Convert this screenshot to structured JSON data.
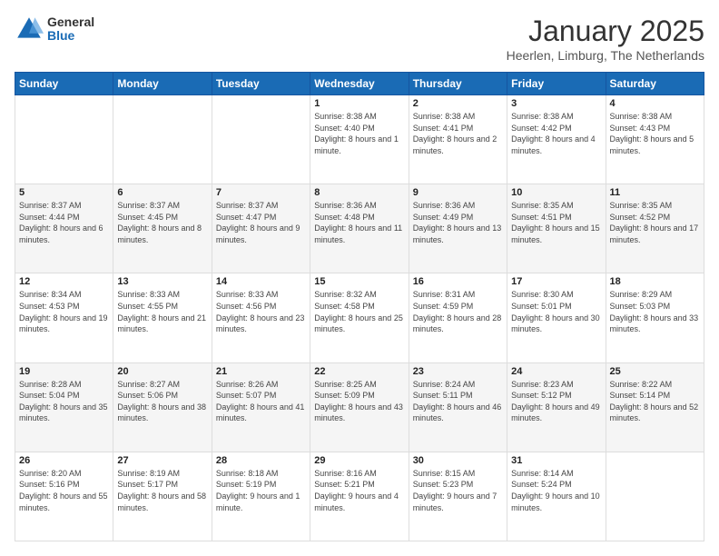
{
  "logo": {
    "general": "General",
    "blue": "Blue"
  },
  "header": {
    "month": "January 2025",
    "location": "Heerlen, Limburg, The Netherlands"
  },
  "weekdays": [
    "Sunday",
    "Monday",
    "Tuesday",
    "Wednesday",
    "Thursday",
    "Friday",
    "Saturday"
  ],
  "weeks": [
    [
      {
        "day": "",
        "sunrise": "",
        "sunset": "",
        "daylight": ""
      },
      {
        "day": "",
        "sunrise": "",
        "sunset": "",
        "daylight": ""
      },
      {
        "day": "",
        "sunrise": "",
        "sunset": "",
        "daylight": ""
      },
      {
        "day": "1",
        "sunrise": "Sunrise: 8:38 AM",
        "sunset": "Sunset: 4:40 PM",
        "daylight": "Daylight: 8 hours and 1 minute."
      },
      {
        "day": "2",
        "sunrise": "Sunrise: 8:38 AM",
        "sunset": "Sunset: 4:41 PM",
        "daylight": "Daylight: 8 hours and 2 minutes."
      },
      {
        "day": "3",
        "sunrise": "Sunrise: 8:38 AM",
        "sunset": "Sunset: 4:42 PM",
        "daylight": "Daylight: 8 hours and 4 minutes."
      },
      {
        "day": "4",
        "sunrise": "Sunrise: 8:38 AM",
        "sunset": "Sunset: 4:43 PM",
        "daylight": "Daylight: 8 hours and 5 minutes."
      }
    ],
    [
      {
        "day": "5",
        "sunrise": "Sunrise: 8:37 AM",
        "sunset": "Sunset: 4:44 PM",
        "daylight": "Daylight: 8 hours and 6 minutes."
      },
      {
        "day": "6",
        "sunrise": "Sunrise: 8:37 AM",
        "sunset": "Sunset: 4:45 PM",
        "daylight": "Daylight: 8 hours and 8 minutes."
      },
      {
        "day": "7",
        "sunrise": "Sunrise: 8:37 AM",
        "sunset": "Sunset: 4:47 PM",
        "daylight": "Daylight: 8 hours and 9 minutes."
      },
      {
        "day": "8",
        "sunrise": "Sunrise: 8:36 AM",
        "sunset": "Sunset: 4:48 PM",
        "daylight": "Daylight: 8 hours and 11 minutes."
      },
      {
        "day": "9",
        "sunrise": "Sunrise: 8:36 AM",
        "sunset": "Sunset: 4:49 PM",
        "daylight": "Daylight: 8 hours and 13 minutes."
      },
      {
        "day": "10",
        "sunrise": "Sunrise: 8:35 AM",
        "sunset": "Sunset: 4:51 PM",
        "daylight": "Daylight: 8 hours and 15 minutes."
      },
      {
        "day": "11",
        "sunrise": "Sunrise: 8:35 AM",
        "sunset": "Sunset: 4:52 PM",
        "daylight": "Daylight: 8 hours and 17 minutes."
      }
    ],
    [
      {
        "day": "12",
        "sunrise": "Sunrise: 8:34 AM",
        "sunset": "Sunset: 4:53 PM",
        "daylight": "Daylight: 8 hours and 19 minutes."
      },
      {
        "day": "13",
        "sunrise": "Sunrise: 8:33 AM",
        "sunset": "Sunset: 4:55 PM",
        "daylight": "Daylight: 8 hours and 21 minutes."
      },
      {
        "day": "14",
        "sunrise": "Sunrise: 8:33 AM",
        "sunset": "Sunset: 4:56 PM",
        "daylight": "Daylight: 8 hours and 23 minutes."
      },
      {
        "day": "15",
        "sunrise": "Sunrise: 8:32 AM",
        "sunset": "Sunset: 4:58 PM",
        "daylight": "Daylight: 8 hours and 25 minutes."
      },
      {
        "day": "16",
        "sunrise": "Sunrise: 8:31 AM",
        "sunset": "Sunset: 4:59 PM",
        "daylight": "Daylight: 8 hours and 28 minutes."
      },
      {
        "day": "17",
        "sunrise": "Sunrise: 8:30 AM",
        "sunset": "Sunset: 5:01 PM",
        "daylight": "Daylight: 8 hours and 30 minutes."
      },
      {
        "day": "18",
        "sunrise": "Sunrise: 8:29 AM",
        "sunset": "Sunset: 5:03 PM",
        "daylight": "Daylight: 8 hours and 33 minutes."
      }
    ],
    [
      {
        "day": "19",
        "sunrise": "Sunrise: 8:28 AM",
        "sunset": "Sunset: 5:04 PM",
        "daylight": "Daylight: 8 hours and 35 minutes."
      },
      {
        "day": "20",
        "sunrise": "Sunrise: 8:27 AM",
        "sunset": "Sunset: 5:06 PM",
        "daylight": "Daylight: 8 hours and 38 minutes."
      },
      {
        "day": "21",
        "sunrise": "Sunrise: 8:26 AM",
        "sunset": "Sunset: 5:07 PM",
        "daylight": "Daylight: 8 hours and 41 minutes."
      },
      {
        "day": "22",
        "sunrise": "Sunrise: 8:25 AM",
        "sunset": "Sunset: 5:09 PM",
        "daylight": "Daylight: 8 hours and 43 minutes."
      },
      {
        "day": "23",
        "sunrise": "Sunrise: 8:24 AM",
        "sunset": "Sunset: 5:11 PM",
        "daylight": "Daylight: 8 hours and 46 minutes."
      },
      {
        "day": "24",
        "sunrise": "Sunrise: 8:23 AM",
        "sunset": "Sunset: 5:12 PM",
        "daylight": "Daylight: 8 hours and 49 minutes."
      },
      {
        "day": "25",
        "sunrise": "Sunrise: 8:22 AM",
        "sunset": "Sunset: 5:14 PM",
        "daylight": "Daylight: 8 hours and 52 minutes."
      }
    ],
    [
      {
        "day": "26",
        "sunrise": "Sunrise: 8:20 AM",
        "sunset": "Sunset: 5:16 PM",
        "daylight": "Daylight: 8 hours and 55 minutes."
      },
      {
        "day": "27",
        "sunrise": "Sunrise: 8:19 AM",
        "sunset": "Sunset: 5:17 PM",
        "daylight": "Daylight: 8 hours and 58 minutes."
      },
      {
        "day": "28",
        "sunrise": "Sunrise: 8:18 AM",
        "sunset": "Sunset: 5:19 PM",
        "daylight": "Daylight: 9 hours and 1 minute."
      },
      {
        "day": "29",
        "sunrise": "Sunrise: 8:16 AM",
        "sunset": "Sunset: 5:21 PM",
        "daylight": "Daylight: 9 hours and 4 minutes."
      },
      {
        "day": "30",
        "sunrise": "Sunrise: 8:15 AM",
        "sunset": "Sunset: 5:23 PM",
        "daylight": "Daylight: 9 hours and 7 minutes."
      },
      {
        "day": "31",
        "sunrise": "Sunrise: 8:14 AM",
        "sunset": "Sunset: 5:24 PM",
        "daylight": "Daylight: 9 hours and 10 minutes."
      },
      {
        "day": "",
        "sunrise": "",
        "sunset": "",
        "daylight": ""
      }
    ]
  ]
}
